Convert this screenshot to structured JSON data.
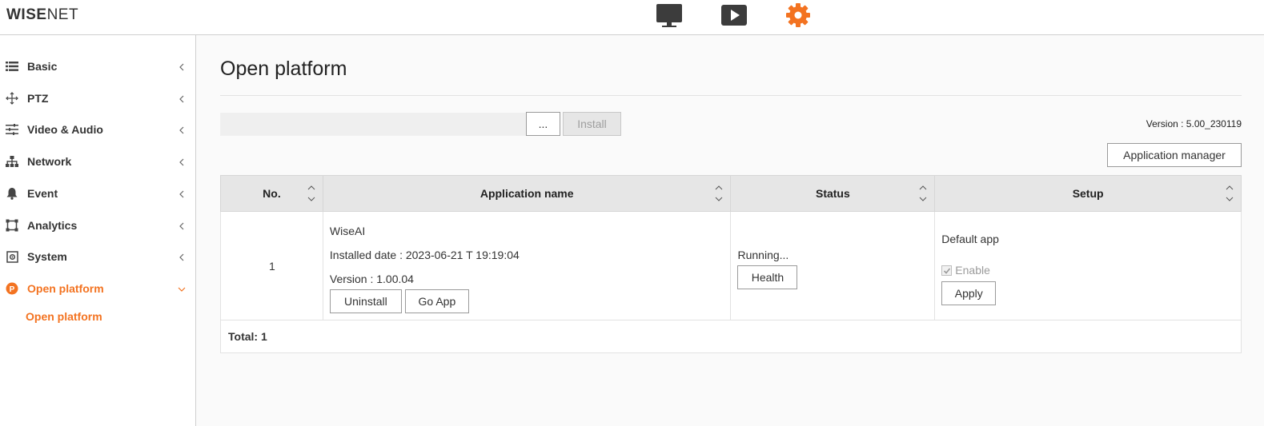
{
  "header": {
    "logo_main": "WISE",
    "logo_sub": "NET",
    "icons": [
      "monitor-icon",
      "play-icon",
      "gear-icon"
    ]
  },
  "sidebar": {
    "items": [
      {
        "label": "Basic",
        "icon": "list-icon"
      },
      {
        "label": "PTZ",
        "icon": "move-arrows-icon"
      },
      {
        "label": "Video & Audio",
        "icon": "sliders-icon"
      },
      {
        "label": "Network",
        "icon": "network-icon"
      },
      {
        "label": "Event",
        "icon": "bell-icon"
      },
      {
        "label": "Analytics",
        "icon": "analytics-frame-icon"
      },
      {
        "label": "System",
        "icon": "system-icon"
      },
      {
        "label": "Open platform",
        "icon": "open-platform-icon"
      }
    ],
    "sub_items": [
      {
        "label": "Open platform"
      }
    ],
    "accent_color": "#f37321"
  },
  "main": {
    "title": "Open platform",
    "browse_label": "...",
    "install_label": "Install",
    "version_text": "Version : 5.00_230119",
    "app_manager_label": "Application manager",
    "table": {
      "headers": [
        "No.",
        "Application name",
        "Status",
        "Setup"
      ],
      "rows": [
        {
          "no": "1",
          "name": "WiseAI",
          "installed": "Installed date : 2023-06-21 T 19:19:04",
          "version": "Version : 1.00.04",
          "uninstall_label": "Uninstall",
          "goapp_label": "Go App",
          "status": "Running...",
          "health_label": "Health",
          "default_app": "Default app",
          "enable_label": "Enable",
          "enable_checked": true,
          "apply_label": "Apply"
        }
      ],
      "total": "Total: 1"
    }
  }
}
